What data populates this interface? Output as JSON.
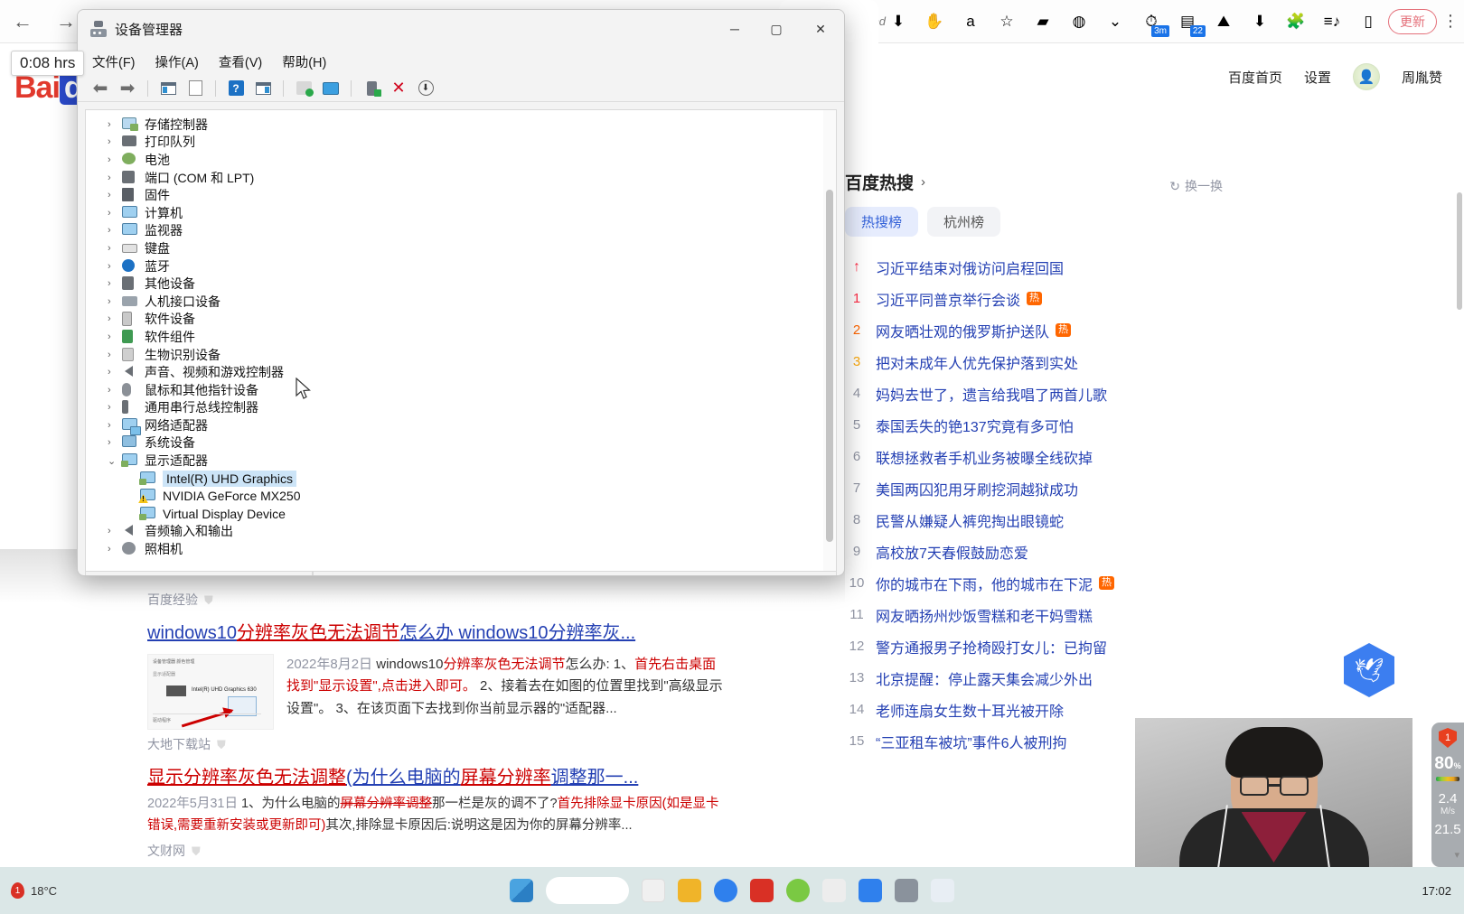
{
  "browser": {
    "back_label": "←",
    "forward_label": "→",
    "tab_close_label": "✕",
    "md_label": "md",
    "extensions": [
      {
        "name": "download-icon",
        "glyph": "⬇",
        "badge": ""
      },
      {
        "name": "adblock-icon",
        "glyph": "✋",
        "badge": ""
      },
      {
        "name": "alipay-icon",
        "glyph": "a",
        "badge": ""
      },
      {
        "name": "bookmark-star-icon",
        "glyph": "☆",
        "badge": ""
      },
      {
        "name": "green-note-icon",
        "glyph": "▰",
        "badge": ""
      },
      {
        "name": "globe-icon",
        "glyph": "◍",
        "badge": ""
      },
      {
        "name": "double-chevron-down-icon",
        "glyph": "⌄",
        "badge": ""
      },
      {
        "name": "timer-icon",
        "glyph": "⏱",
        "badge": "3m"
      },
      {
        "name": "counter-icon",
        "glyph": "▤",
        "badge": "22"
      },
      {
        "name": "mountain-icon",
        "glyph": "⛰",
        "badge": ""
      },
      {
        "name": "download-circle-icon",
        "glyph": "⬇",
        "badge": ""
      },
      {
        "name": "puzzle-extension-icon",
        "glyph": "🧩",
        "badge": ""
      },
      {
        "name": "playlist-icon",
        "glyph": "≡♪",
        "badge": ""
      },
      {
        "name": "sidebar-panel-icon",
        "glyph": "▯",
        "badge": ""
      }
    ],
    "update_button": "更新",
    "menu_dots": "⋮"
  },
  "hover_tooltip": "0:08 hrs",
  "baidu": {
    "logo_bai": "Bai",
    "logo_du": "du",
    "top_links": [
      "百度首页",
      "设置"
    ],
    "user_name": "周胤赞",
    "avatar_glyph": "👤"
  },
  "hot_search": {
    "title": "百度热搜",
    "chevron": "›",
    "refresh_label": "换一换",
    "refresh_icon": "↻",
    "tabs": [
      {
        "label": "热搜榜",
        "active": true
      },
      {
        "label": "杭州榜",
        "active": false
      }
    ],
    "items": [
      {
        "rank": "↑",
        "text": "习近平结束对俄访问启程回国",
        "badge": ""
      },
      {
        "rank": "1",
        "text": "习近平同普京举行会谈",
        "badge": "热"
      },
      {
        "rank": "2",
        "text": "网友晒壮观的俄罗斯护送队",
        "badge": "热"
      },
      {
        "rank": "3",
        "text": "把对未成年人优先保护落到实处",
        "badge": ""
      },
      {
        "rank": "4",
        "text": "妈妈去世了，遗言给我唱了两首儿歌",
        "badge": ""
      },
      {
        "rank": "5",
        "text": "泰国丢失的铯137究竟有多可怕",
        "badge": ""
      },
      {
        "rank": "6",
        "text": "联想拯救者手机业务被曝全线砍掉",
        "badge": ""
      },
      {
        "rank": "7",
        "text": "美国两囚犯用牙刷挖洞越狱成功",
        "badge": ""
      },
      {
        "rank": "8",
        "text": "民警从嫌疑人裤兜掏出眼镜蛇",
        "badge": ""
      },
      {
        "rank": "9",
        "text": "高校放7天春假鼓励恋爱",
        "badge": ""
      },
      {
        "rank": "10",
        "text": "你的城市在下雨，他的城市在下泥",
        "badge": "热"
      },
      {
        "rank": "11",
        "text": "网友晒扬州炒饭雪糕和老干妈雪糕",
        "badge": ""
      },
      {
        "rank": "12",
        "text": "警方通报男子抢椅殴打女儿：已拘留",
        "badge": ""
      },
      {
        "rank": "13",
        "text": "北京提醒：停止露天集会减少外出",
        "badge": ""
      },
      {
        "rank": "14",
        "text": "老师连扇女生数十耳光被开除",
        "badge": ""
      },
      {
        "rank": "15",
        "text": "“三亚租车被坑”事件6人被刑拘",
        "badge": ""
      }
    ]
  },
  "results": {
    "source1": "百度经验",
    "r1_title_a": "windows10",
    "r1_title_b": "分辨率灰色无法调节",
    "r1_title_c": "怎么办 windows10分辨率灰...",
    "r1_date": "2022年8月2日",
    "r1_desc_1": " windows10",
    "r1_desc_2": "分辨率灰色无法调节",
    "r1_desc_3": "怎么办: 1、",
    "r1_desc_4": "首先右击桌面找到\"显示设置\",点击进入即可。",
    "r1_desc_5": " 2、接着去在如图的位置里找到\"高级显示设置\"。 3、在该页面下去找到你当前显示器的\"适配器...",
    "source2": "大地下载站",
    "r2_title_a": "显示分辨率灰色无法调整",
    "r2_title_b": "(为什么电脑的",
    "r2_title_c": "屏幕分辨率",
    "r2_title_d": "调整那一...",
    "r2_date": "2022年5月31日",
    "r2_desc_1": " 1、为什么电脑的",
    "r2_desc_2": "屏幕分辨率调整",
    "r2_desc_3": "那一栏是灰的调不了?",
    "r2_desc_4": "首先排除显卡原因(如是显卡错误,",
    "r2_desc_5": "需要重新安装或更新即可)",
    "r2_desc_6": "其次,排除显卡原因后:说明这是因为你的屏幕分辨率...",
    "source3": "文财网",
    "thumb": {
      "head": "设备管理器    颜色管理",
      "sub": "显示适配器",
      "label": "Intel(R) UHD Graphics 630",
      "foot": "驱动程序"
    }
  },
  "device_manager": {
    "title": "设备管理器",
    "window_buttons": {
      "minimize": "─",
      "maximize": "▢",
      "close": "✕"
    },
    "menus": [
      "文件(F)",
      "操作(A)",
      "查看(V)",
      "帮助(H)"
    ],
    "toolbar": [
      {
        "name": "back-icon",
        "glyph": "⬅"
      },
      {
        "name": "forward-icon",
        "glyph": "➡"
      },
      {
        "name": "show-properties-icon",
        "glyph": ""
      },
      {
        "name": "properties-page-icon",
        "glyph": ""
      },
      {
        "name": "help-icon",
        "glyph": "?"
      },
      {
        "name": "view-devices-icon",
        "glyph": ""
      },
      {
        "name": "scan-hardware-changes-icon",
        "glyph": ""
      },
      {
        "name": "update-driver-icon",
        "glyph": ""
      },
      {
        "name": "enable-device-icon",
        "glyph": ""
      },
      {
        "name": "uninstall-device-icon",
        "glyph": "✕"
      },
      {
        "name": "disable-device-icon",
        "glyph": "⬇"
      }
    ],
    "tree": [
      {
        "label": "存储控制器",
        "expanded": false,
        "icon": "ic-store",
        "indent": 0
      },
      {
        "label": "打印队列",
        "expanded": false,
        "icon": "ic-print",
        "indent": 0
      },
      {
        "label": "电池",
        "expanded": false,
        "icon": "ic-batt",
        "indent": 0
      },
      {
        "label": "端口 (COM 和 LPT)",
        "expanded": false,
        "icon": "ic-port",
        "indent": 0
      },
      {
        "label": "固件",
        "expanded": false,
        "icon": "ic-chip",
        "indent": 0
      },
      {
        "label": "计算机",
        "expanded": false,
        "icon": "ic-monitor",
        "indent": 0
      },
      {
        "label": "监视器",
        "expanded": false,
        "icon": "ic-monitor",
        "indent": 0
      },
      {
        "label": "键盘",
        "expanded": false,
        "icon": "ic-kbd",
        "indent": 0
      },
      {
        "label": "蓝牙",
        "expanded": false,
        "icon": "ic-bt",
        "indent": 0
      },
      {
        "label": "其他设备",
        "expanded": false,
        "icon": "ic-dark",
        "indent": 0
      },
      {
        "label": "人机接口设备",
        "expanded": false,
        "icon": "ic-hid",
        "indent": 0
      },
      {
        "label": "软件设备",
        "expanded": false,
        "icon": "ic-grey",
        "indent": 0
      },
      {
        "label": "软件组件",
        "expanded": false,
        "icon": "ic-sw",
        "indent": 0
      },
      {
        "label": "生物识别设备",
        "expanded": false,
        "icon": "ic-bio",
        "indent": 0
      },
      {
        "label": "声音、视频和游戏控制器",
        "expanded": false,
        "icon": "ic-speaker",
        "indent": 0
      },
      {
        "label": "鼠标和其他指针设备",
        "expanded": false,
        "icon": "ic-mouse",
        "indent": 0
      },
      {
        "label": "通用串行总线控制器",
        "expanded": false,
        "icon": "ic-usb",
        "indent": 0
      },
      {
        "label": "网络适配器",
        "expanded": false,
        "icon": "ic-monitor net",
        "indent": 0
      },
      {
        "label": "系统设备",
        "expanded": false,
        "icon": "ic-sys",
        "indent": 0
      },
      {
        "label": "显示适配器",
        "expanded": true,
        "icon": "ic-adapter ok",
        "indent": 0
      },
      {
        "label": "Intel(R) UHD Graphics",
        "expanded": null,
        "icon": "ic-adapter ok",
        "indent": 1,
        "selected": true
      },
      {
        "label": "NVIDIA GeForce MX250",
        "expanded": null,
        "icon": "ic-adapter warn",
        "indent": 1
      },
      {
        "label": "Virtual Display Device",
        "expanded": null,
        "icon": "ic-adapter ok",
        "indent": 1
      },
      {
        "label": "音频输入和输出",
        "expanded": false,
        "icon": "ic-speaker",
        "indent": 0
      },
      {
        "label": "照相机",
        "expanded": false,
        "icon": "ic-cam",
        "indent": 0
      }
    ],
    "chevron_closed": "›",
    "chevron_open": "⌄"
  },
  "widgets": {
    "bird_glyph": "🕊",
    "shield_count": "1",
    "cpu_percent": "80",
    "percent_sign": "%",
    "net_up": "2.4",
    "net_up_unit": "M/s",
    "net_down": "21.5",
    "scroll_caret": "▾"
  },
  "taskbar": {
    "temperature": "18°C",
    "weather_badge": "1",
    "clock": "17:02"
  }
}
